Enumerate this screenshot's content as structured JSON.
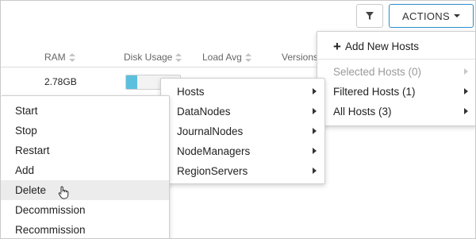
{
  "toolbar": {
    "filter_icon": "filter-icon",
    "actions_label": "ACTIONS"
  },
  "table": {
    "headers": [
      "RAM",
      "Disk Usage",
      "Load Avg",
      "Versions"
    ],
    "row": {
      "ram": "2.78GB",
      "disk_usage_fraction": 0.2
    }
  },
  "actions_menu": {
    "add_new_hosts": "Add New Hosts",
    "items": [
      {
        "label": "Selected Hosts (0)",
        "disabled": true
      },
      {
        "label": "Filtered Hosts (1)",
        "disabled": false
      },
      {
        "label": "All Hosts (3)",
        "disabled": false
      }
    ]
  },
  "role_menu": {
    "items": [
      "Hosts",
      "DataNodes",
      "JournalNodes",
      "NodeManagers",
      "RegionServers"
    ]
  },
  "command_menu": {
    "items": [
      "Start",
      "Stop",
      "Restart",
      "Add",
      "Delete",
      "Decommission",
      "Recommission"
    ],
    "hovered_index": 4
  },
  "colors": {
    "accent": "#2e8bc9",
    "disk_fill": "#5bc0de",
    "disabled_text": "#9a9a9a",
    "hover_bg": "#ececec"
  }
}
